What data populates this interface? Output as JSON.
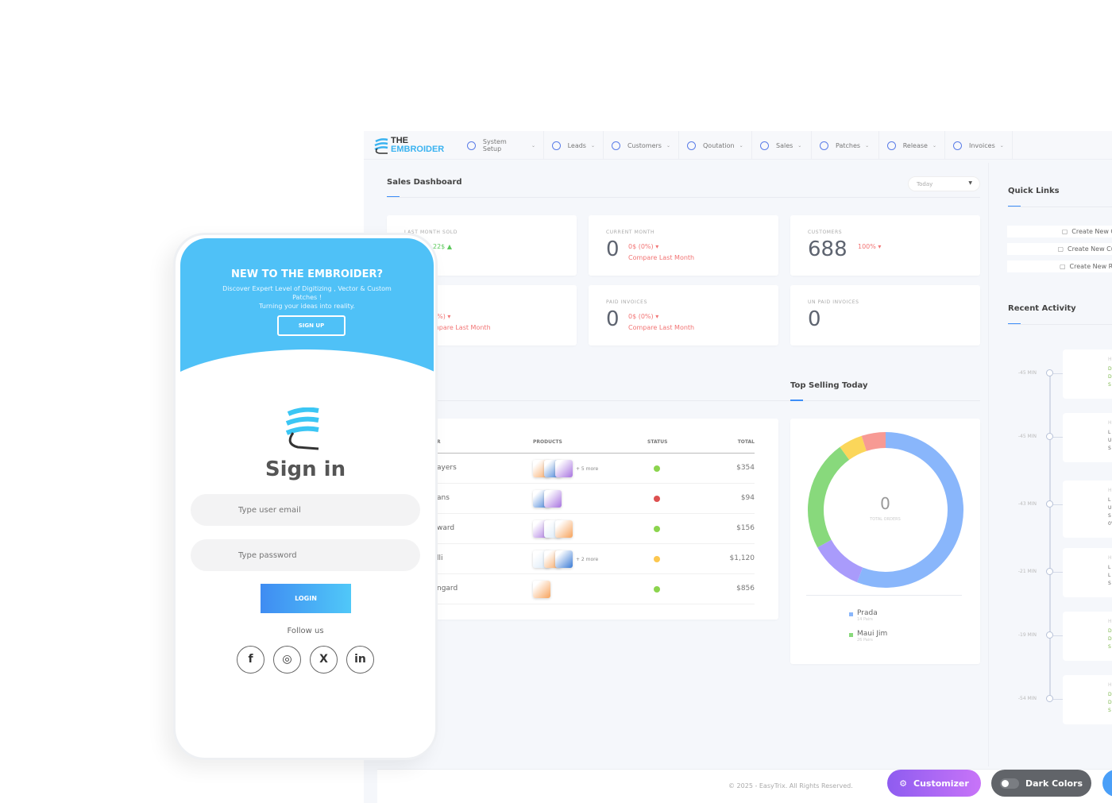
{
  "nav": {
    "brand_line1": "THE",
    "brand_line2": "EMBROIDER",
    "items": [
      {
        "label": "System Setup",
        "icon": "users-icon"
      },
      {
        "label": "Leads",
        "icon": "lifebuoy-icon"
      },
      {
        "label": "Customers",
        "icon": "layers-icon"
      },
      {
        "label": "Qoutation",
        "icon": "lifebuoy-icon"
      },
      {
        "label": "Sales",
        "icon": "box-icon"
      },
      {
        "label": "Patches",
        "icon": "box-icon"
      },
      {
        "label": "Release",
        "icon": "lifebuoy-icon"
      },
      {
        "label": "Invoices",
        "icon": "file-icon"
      }
    ]
  },
  "dashboard": {
    "title": "Sales Dashboard",
    "period": "Today",
    "stats": [
      {
        "label": "LAST MONTH SOLD",
        "change": "22$ ▲",
        "change_color": "#5cc95c"
      },
      {
        "label": "CURRENT MONTH",
        "value": "0",
        "change": "0$ (0%) ▾",
        "compare": "Compare Last Month"
      },
      {
        "label": "CUSTOMERS",
        "value": "688",
        "change": "100% ▾"
      },
      {
        "change": "0%) ▾",
        "compare": "mpare Last Month"
      },
      {
        "label": "PAID INVOICES",
        "value": "0",
        "change": "0$ (0%) ▾",
        "compare": "Compare Last Month"
      },
      {
        "label": "UN PAID INVOICES",
        "value": "0"
      }
    ]
  },
  "orders": {
    "columns": [
      "R",
      "PRODUCTS",
      "STATUS",
      "TOTAL"
    ],
    "rows": [
      {
        "customer": "ayers",
        "more": "+ 5 more",
        "status": "#8cd44e",
        "total": "$354",
        "thumbs": 3
      },
      {
        "customer": "ans",
        "more": "",
        "status": "#dd5050",
        "total": "$94",
        "thumbs": 2
      },
      {
        "customer": "ward",
        "more": "",
        "status": "#8cd44e",
        "total": "$156",
        "thumbs": 3
      },
      {
        "customer": "lli",
        "more": "+ 2 more",
        "status": "#fcc74f",
        "total": "$1,120",
        "thumbs": 3
      },
      {
        "customer": "ngard",
        "more": "",
        "status": "#8cd44e",
        "total": "$856",
        "thumbs": 1
      }
    ]
  },
  "top_selling": {
    "title": "Top Selling Today",
    "center_value": "0",
    "center_label": "TOTAL ORDERS",
    "legend": [
      {
        "name": "Prada",
        "sub": "14 Pairs",
        "color": "#89b6fb"
      },
      {
        "name": "Maui Jim",
        "sub": "26 Pairs",
        "color": "#88d97c"
      }
    ],
    "segments": [
      {
        "share": 56,
        "color": "#89b6fb"
      },
      {
        "share": 11,
        "color": "#a99bfb"
      },
      {
        "share": 23,
        "color": "#88d97c"
      },
      {
        "share": 5,
        "color": "#fbd65a"
      },
      {
        "share": 5,
        "color": "#f79a94"
      }
    ]
  },
  "quick_links": {
    "title": "Quick Links",
    "items": [
      {
        "label": "Create New Or",
        "icon": "box-icon"
      },
      {
        "label": "Create New Cus",
        "icon": "calendar-icon"
      },
      {
        "label": "Create New Rel",
        "icon": "folder-icon"
      }
    ]
  },
  "recent_activity": {
    "title": "Recent Activity",
    "items": [
      {
        "time": "-45 MIN",
        "lines": [
          "H",
          "D.",
          "D.",
          "S"
        ],
        "color": "#7ab648"
      },
      {
        "time": "-45 MIN",
        "lines": [
          "H",
          "L",
          "U",
          "S"
        ],
        "color": "#666"
      },
      {
        "time": "-43 MIN",
        "lines": [
          "H",
          "L",
          "U",
          "S",
          "0'"
        ],
        "color": "#666"
      },
      {
        "time": "-21 MIN",
        "lines": [
          "H",
          "L",
          "L",
          "S"
        ],
        "color": "#666"
      },
      {
        "time": "-19 MIN",
        "lines": [
          "H",
          "D.",
          "D.",
          "S"
        ],
        "color": "#7ab648"
      },
      {
        "time": "-54 MIN",
        "lines": [
          "H",
          "D.",
          "D.",
          "S"
        ],
        "color": "#7ab648"
      }
    ]
  },
  "footer": {
    "copyright": "© 2025 - EasyTrix. All Rights Reserved.",
    "customizer": "Customizer",
    "dark": "Dark Colors"
  },
  "phone": {
    "hero_title": "NEW TO THE EMBROIDER?",
    "hero_text1": "Discover Expert Level of Digitizing , Vector & Custom Patches !",
    "hero_text2": "Turning your ideas into reality.",
    "signup": "SIGN UP",
    "signin": "Sign in",
    "email_placeholder": "Type user email",
    "password_placeholder": "Type password",
    "login": "LOGIN",
    "follow": "Follow us",
    "socials": [
      "f",
      "◎",
      "X",
      "in"
    ]
  }
}
